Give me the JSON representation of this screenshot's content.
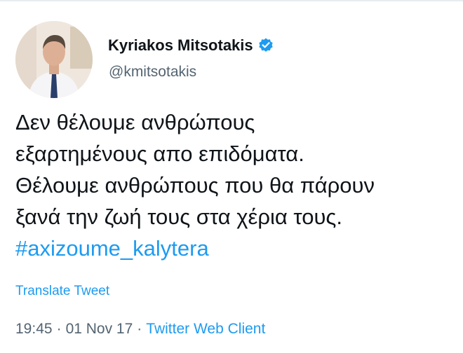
{
  "tweet": {
    "author": {
      "display_name": "Kyriakos Mitsotakis",
      "handle": "@kmitsotakis",
      "verified": true
    },
    "text_lines": [
      "Δεν θέλουμε ανθρώπους",
      "εξαρτημένους απο επιδόματα.",
      "Θέλουμε ανθρώπους που θα πάρουν",
      "ξανά την ζωή τους στα χέρια τους."
    ],
    "hashtag": "#axizoume_kalytera",
    "translate_label": "Translate Tweet",
    "meta": {
      "time": "19:45",
      "separator": "·",
      "date": "01 Nov 17",
      "source": "Twitter Web Client"
    }
  },
  "colors": {
    "text": "#0f1419",
    "secondary": "#536471",
    "link": "#1d9bf0"
  },
  "icons": {
    "verified": "verified-badge-icon",
    "avatar": "profile-photo"
  }
}
